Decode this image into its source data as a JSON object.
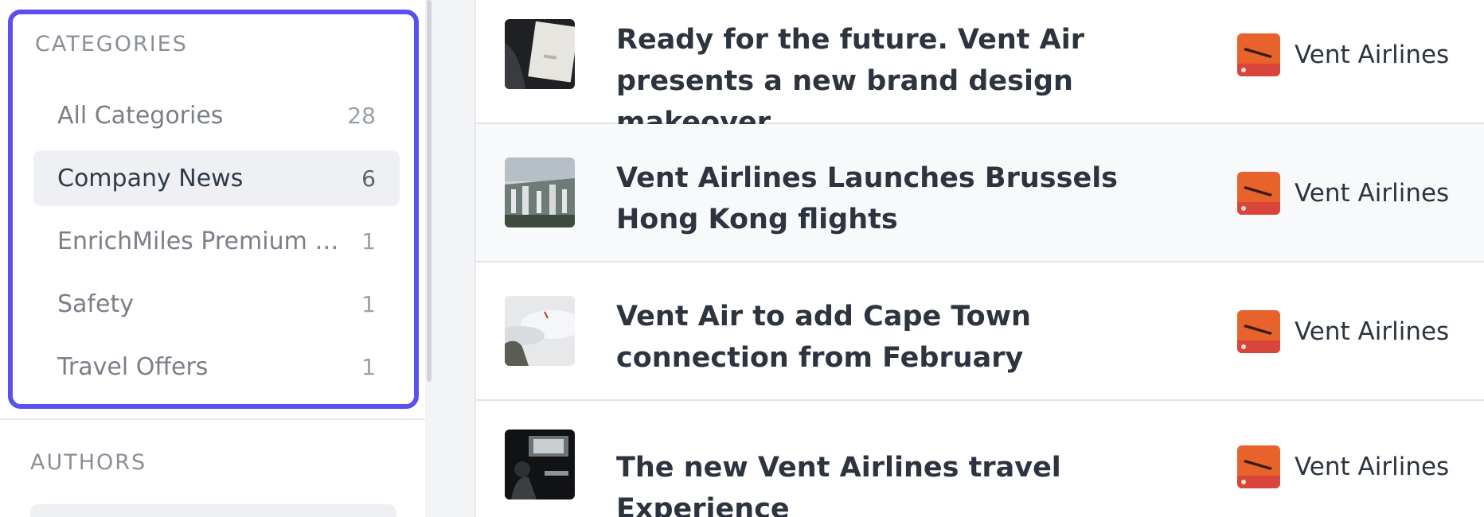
{
  "sidebar": {
    "categories_title": "CATEGORIES",
    "categories": [
      {
        "label": "All Categories",
        "count": "28"
      },
      {
        "label": "Company News",
        "count": "6"
      },
      {
        "label": "EnrichMiles Premium C...",
        "count": "1"
      },
      {
        "label": "Safety",
        "count": "1"
      },
      {
        "label": "Travel Offers",
        "count": "1"
      }
    ],
    "active_category": "Company News",
    "authors_title": "AUTHORS"
  },
  "articles": [
    {
      "title": "Ready for the future. Vent Air presents a new brand design makeover.",
      "author": "Vent Airlines",
      "thumbnail": "brand-booklet-photo"
    },
    {
      "title": "Vent Airlines Launches Brussels Hong Kong flights",
      "author": "Vent Airlines",
      "thumbnail": "hong-kong-skyline-photo"
    },
    {
      "title": "Vent Air to add Cape Town connection from February",
      "author": "Vent Airlines",
      "thumbnail": "cape-town-clouds-photo"
    },
    {
      "title": "The new Vent Airlines travel Experience",
      "author": "Vent Airlines",
      "thumbnail": "cabin-interior-photo"
    }
  ],
  "colors": {
    "highlight_border": "#5a4ff0",
    "active_bg": "#eef0f3",
    "avatar_orange": "#e8632b"
  }
}
